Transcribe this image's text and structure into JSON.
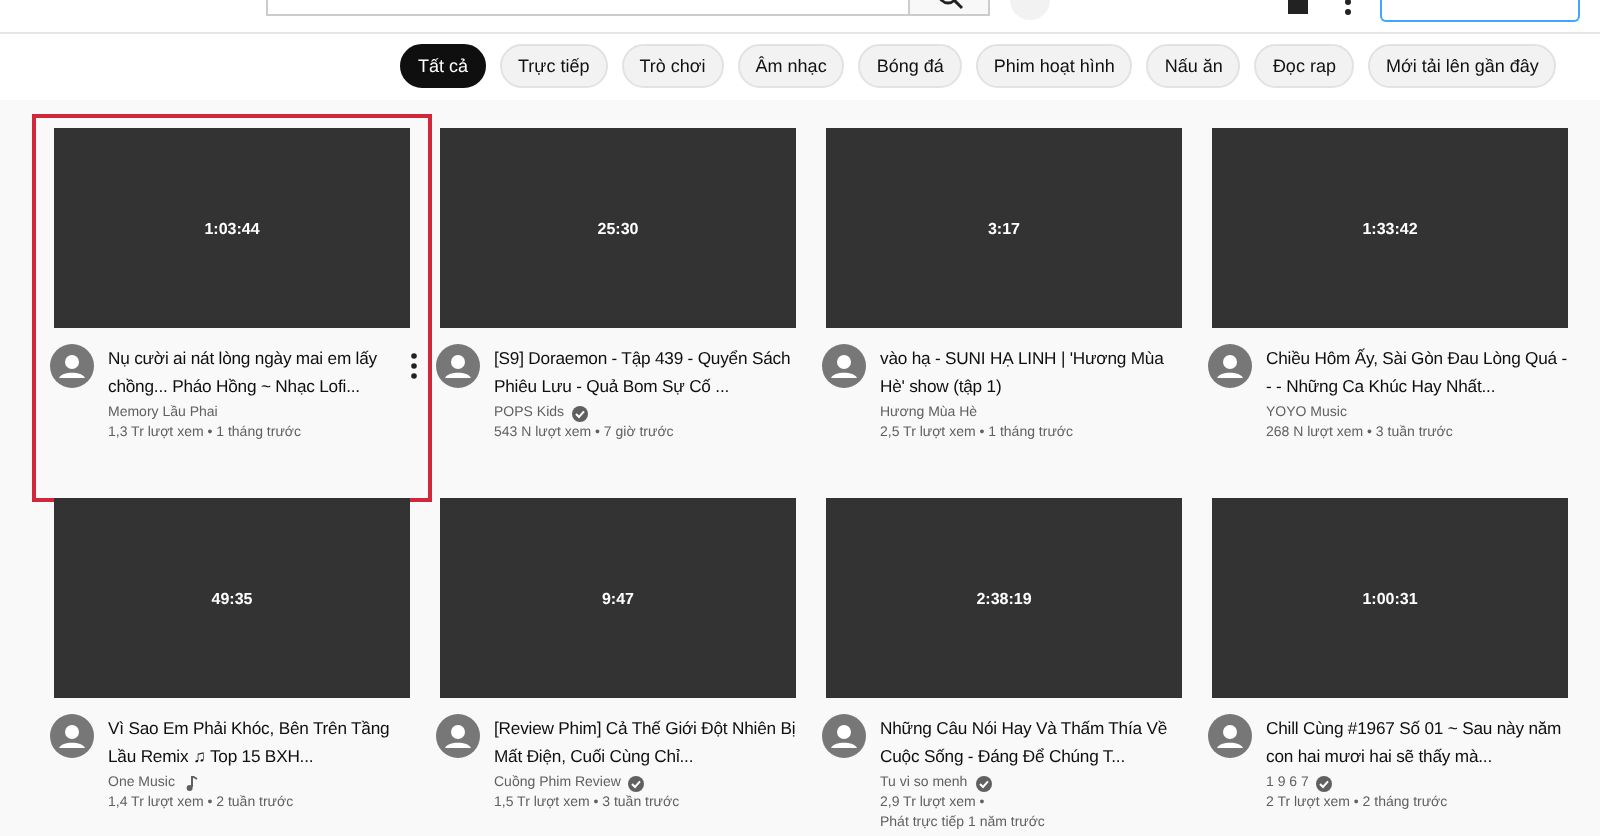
{
  "chips": [
    {
      "label": "Tất cả",
      "selected": true
    },
    {
      "label": "Trực tiếp",
      "selected": false
    },
    {
      "label": "Trò chơi",
      "selected": false
    },
    {
      "label": "Âm nhạc",
      "selected": false
    },
    {
      "label": "Bóng đá",
      "selected": false
    },
    {
      "label": "Phim hoạt hình",
      "selected": false
    },
    {
      "label": "Nấu ăn",
      "selected": false
    },
    {
      "label": "Đọc rap",
      "selected": false
    },
    {
      "label": "Mới tải lên gần đây",
      "selected": false
    }
  ],
  "videos": [
    {
      "duration": "1:03:44",
      "title": "Nụ cười ai nát lòng ngày mai em lấy chồng... Pháo Hồng ~ Nhạc Lofi...",
      "channel": "Memory Lầu Phai",
      "verified": false,
      "music_note": false,
      "meta_lines": [
        "1,3 Tr lượt xem • 1 tháng trước"
      ],
      "highlighted": true
    },
    {
      "duration": "25:30",
      "title": "[S9] Doraemon - Tập 439 - Quyển Sách Phiêu Lưu - Quả Bom Sự Cố ...",
      "channel": "POPS Kids",
      "verified": true,
      "music_note": false,
      "meta_lines": [
        "543 N lượt xem • 7 giờ trước"
      ],
      "highlighted": false
    },
    {
      "duration": "3:17",
      "title": "vào hạ - SUNI HẠ LINH | 'Hương Mùa Hè' show (tập 1)",
      "channel": "Hương Mùa Hè",
      "verified": false,
      "music_note": false,
      "meta_lines": [
        "2,5 Tr lượt xem • 1 tháng trước"
      ],
      "highlighted": false
    },
    {
      "duration": "1:33:42",
      "title": "Chiều Hôm Ấy, Sài Gòn Đau Lòng Quá - - - Những Ca Khúc Hay Nhất...",
      "channel": "YOYO Music",
      "verified": false,
      "music_note": false,
      "meta_lines": [
        "268 N lượt xem • 3 tuần trước"
      ],
      "highlighted": false
    },
    {
      "duration": "49:35",
      "title": "Vì Sao Em Phải Khóc, Bên Trên Tầng Lầu Remix ♫ Top 15 BXH...",
      "channel": "One Music",
      "verified": false,
      "music_note": true,
      "meta_lines": [
        "1,4 Tr lượt xem • 2 tuần trước"
      ],
      "highlighted": false
    },
    {
      "duration": "9:47",
      "title": "[Review Phim] Cả Thế Giới Đột Nhiên Bị Mất Điện, Cuối Cùng Chỉ...",
      "channel": "Cuồng Phim Review",
      "verified": true,
      "music_note": false,
      "meta_lines": [
        "1,5 Tr lượt xem • 3 tuần trước"
      ],
      "highlighted": false
    },
    {
      "duration": "2:38:19",
      "title": "Những Câu Nói Hay Và Thấm Thía Về Cuộc Sống - Đáng Để Chúng T...",
      "channel": "Tu vi so menh",
      "verified": true,
      "music_note": false,
      "meta_lines": [
        "2,9 Tr lượt xem •",
        "Phát trực tiếp 1 năm trước"
      ],
      "highlighted": false
    },
    {
      "duration": "1:00:31",
      "title": "Chill Cùng #1967 Số 01 ~ Sau này năm con hai mươi hai sẽ thấy mà...",
      "channel": "1 9 6 7",
      "verified": true,
      "music_note": false,
      "meta_lines": [
        "2 Tr lượt xem • 2 tháng trước"
      ],
      "highlighted": false
    }
  ]
}
